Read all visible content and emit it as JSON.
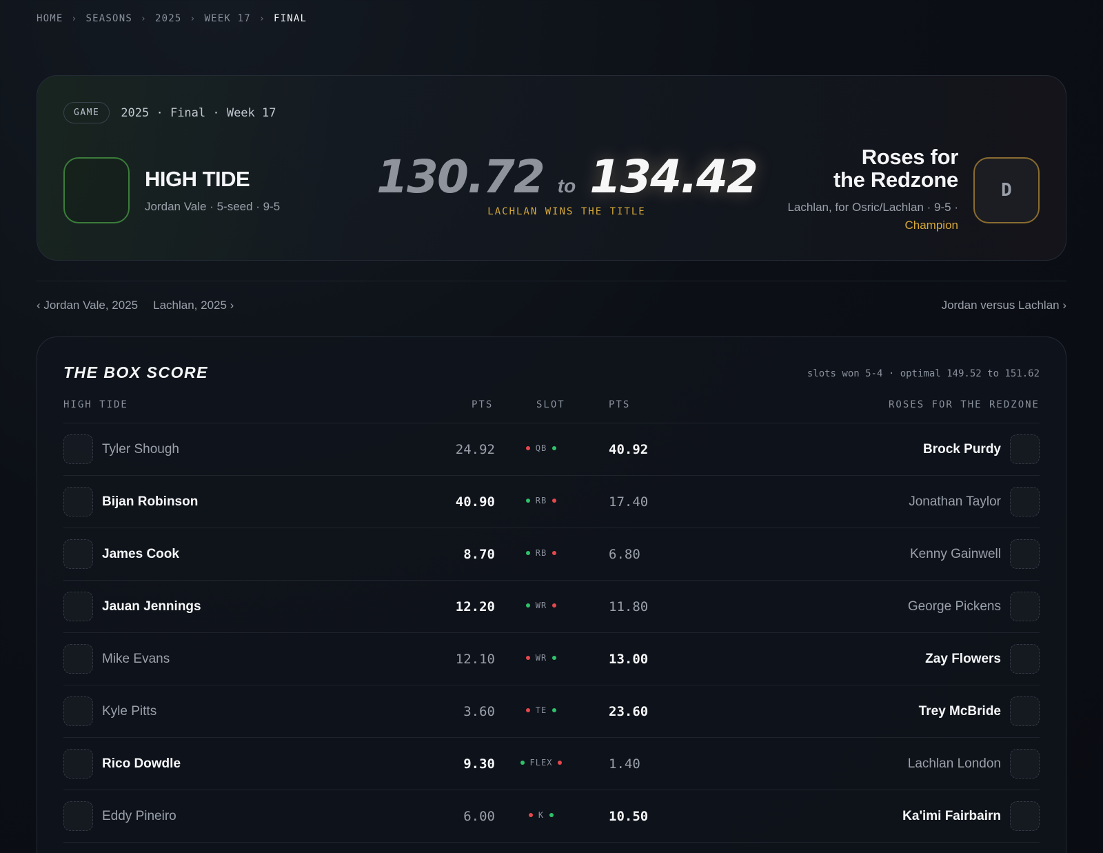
{
  "breadcrumb": {
    "items": [
      "HOME",
      "SEASONS",
      "2025",
      "WEEK 17"
    ],
    "current": "FINAL",
    "separator": "›"
  },
  "game": {
    "pill": "GAME",
    "meta": "2025 · Final · Week 17",
    "left_team": {
      "name": "HIGH TIDE",
      "subtitle": "Jordan Vale · 5-seed · 9-5",
      "score": "130.72"
    },
    "right_team": {
      "name_line1": "Roses for",
      "name_line2": "the Redzone",
      "subtitle": "Lachlan, for Osric/Lachlan · 9-5 ·",
      "badge": "Champion",
      "logo_letter": "D",
      "score": "134.42"
    },
    "to_word": "to",
    "verdict": "LACHLAN WINS THE TITLE"
  },
  "nav": {
    "prev": "‹ Jordan Vale, 2025",
    "next": "Lachlan, 2025 ›",
    "h2h": "Jordan versus Lachlan ›"
  },
  "box_score": {
    "title": "THE BOX SCORE",
    "summary": "slots won 5-4 · optimal 149.52 to 151.62",
    "headers": {
      "left_team": "HIGH TIDE",
      "pts_left": "PTS",
      "slot": "SLOT",
      "pts_right": "PTS",
      "right_team": "ROSES FOR THE REDZONE"
    },
    "rows": [
      {
        "left": "Tyler Shough",
        "left_pts": "24.92",
        "slot": "QB",
        "right_pts": "40.92",
        "right": "Brock Purdy",
        "winner": "right"
      },
      {
        "left": "Bijan Robinson",
        "left_pts": "40.90",
        "slot": "RB",
        "right_pts": "17.40",
        "right": "Jonathan Taylor",
        "winner": "left"
      },
      {
        "left": "James Cook",
        "left_pts": "8.70",
        "slot": "RB",
        "right_pts": "6.80",
        "right": "Kenny Gainwell",
        "winner": "left"
      },
      {
        "left": "Jauan Jennings",
        "left_pts": "12.20",
        "slot": "WR",
        "right_pts": "11.80",
        "right": "George Pickens",
        "winner": "left"
      },
      {
        "left": "Mike Evans",
        "left_pts": "12.10",
        "slot": "WR",
        "right_pts": "13.00",
        "right": "Zay Flowers",
        "winner": "right"
      },
      {
        "left": "Kyle Pitts",
        "left_pts": "3.60",
        "slot": "TE",
        "right_pts": "23.60",
        "right": "Trey McBride",
        "winner": "right"
      },
      {
        "left": "Rico Dowdle",
        "left_pts": "9.30",
        "slot": "FLEX",
        "right_pts": "1.40",
        "right": "Lachlan London",
        "winner": "left"
      },
      {
        "left": "Eddy Pineiro",
        "left_pts": "6.00",
        "slot": "K",
        "right_pts": "10.50",
        "right": "Ka'imi Fairbairn",
        "winner": "right"
      }
    ]
  },
  "colors": {
    "win_dot": "#2ec26a",
    "lose_dot": "#e5484d",
    "gold": "#d7a93a",
    "left_logo_border": "#3a7d3a"
  }
}
